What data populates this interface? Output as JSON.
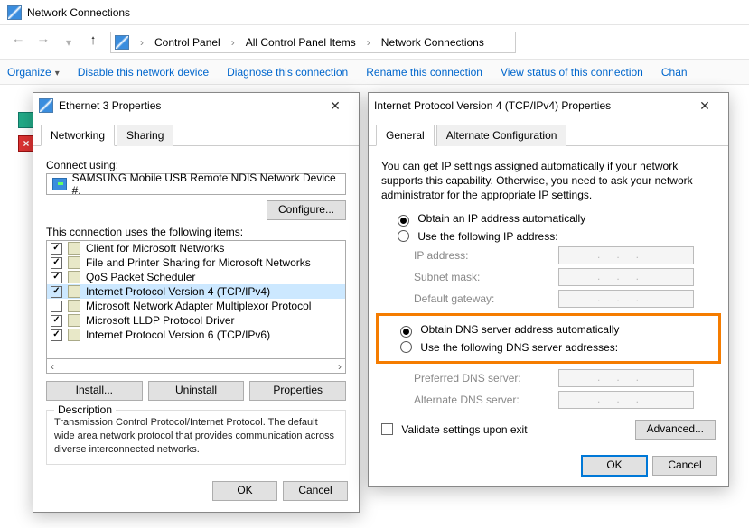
{
  "explorer": {
    "title": "Network Connections",
    "crumbs": [
      "Control Panel",
      "All Control Panel Items",
      "Network Connections"
    ]
  },
  "commands": {
    "organize": "Organize",
    "disable": "Disable this network device",
    "diagnose": "Diagnose this connection",
    "rename": "Rename this connection",
    "viewstatus": "View status of this connection",
    "change": "Chan"
  },
  "eth": {
    "title": "Ethernet 3 Properties",
    "tabs": {
      "networking": "Networking",
      "sharing": "Sharing"
    },
    "connect_using": "Connect using:",
    "adapter": "SAMSUNG Mobile USB Remote NDIS Network Device #.",
    "configure": "Configure...",
    "items_label": "This connection uses the following items:",
    "items": [
      {
        "checked": true,
        "label": "Client for Microsoft Networks"
      },
      {
        "checked": true,
        "label": "File and Printer Sharing for Microsoft Networks"
      },
      {
        "checked": true,
        "label": "QoS Packet Scheduler"
      },
      {
        "checked": true,
        "label": "Internet Protocol Version 4 (TCP/IPv4)",
        "selected": true
      },
      {
        "checked": false,
        "label": "Microsoft Network Adapter Multiplexor Protocol"
      },
      {
        "checked": true,
        "label": "Microsoft LLDP Protocol Driver"
      },
      {
        "checked": true,
        "label": "Internet Protocol Version 6 (TCP/IPv6)"
      }
    ],
    "install": "Install...",
    "uninstall": "Uninstall",
    "properties": "Properties",
    "desc_title": "Description",
    "description": "Transmission Control Protocol/Internet Protocol. The default wide area network protocol that provides communication across diverse interconnected networks.",
    "ok": "OK",
    "cancel": "Cancel"
  },
  "ipv4": {
    "title": "Internet Protocol Version 4 (TCP/IPv4) Properties",
    "tabs": {
      "general": "General",
      "alt": "Alternate Configuration"
    },
    "info": "You can get IP settings assigned automatically if your network supports this capability. Otherwise, you need to ask your network administrator for the appropriate IP settings.",
    "opt_auto_ip": "Obtain an IP address automatically",
    "opt_manual_ip": "Use the following IP address:",
    "ip_address": "IP address:",
    "subnet": "Subnet mask:",
    "gateway": "Default gateway:",
    "opt_auto_dns": "Obtain DNS server address automatically",
    "opt_manual_dns": "Use the following DNS server addresses:",
    "pref_dns": "Preferred DNS server:",
    "alt_dns": "Alternate DNS server:",
    "validate": "Validate settings upon exit",
    "advanced": "Advanced...",
    "ok": "OK",
    "cancel": "Cancel"
  }
}
